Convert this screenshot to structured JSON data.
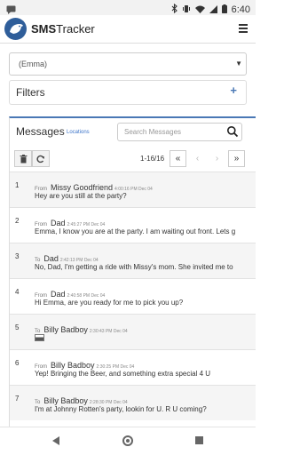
{
  "status_bar": {
    "time": "6:40",
    "icons": [
      "messages-icon",
      "bluetooth-icon",
      "vibrate-icon",
      "wifi-icon",
      "signal-icon",
      "battery-icon"
    ]
  },
  "app": {
    "brand_bold": "SMS",
    "brand_rest": "Tracker"
  },
  "contact_select": {
    "value": "(Emma)"
  },
  "filters": {
    "label": "Filters",
    "add_icon": "plus-icon"
  },
  "messages": {
    "title": "Messages",
    "locations_link": "Locations",
    "search_placeholder": "Search Messages",
    "pager": "1-16/16",
    "accent": "#4a78b5",
    "rows": [
      {
        "num": "1",
        "dir": "From",
        "name": "Missy Goodfriend",
        "time": "4:00:16 PM Dec 04",
        "body": "Hey are you still at the party?"
      },
      {
        "num": "2",
        "dir": "From",
        "name": "Dad",
        "time": "2:45:27 PM Dec 04",
        "body": "Emma, I know you are at the party. I am waiting out front. Lets g"
      },
      {
        "num": "3",
        "dir": "To",
        "name": "Dad",
        "time": "2:42:13 PM Dec 04",
        "body": "No, Dad, I'm getting a ride with Missy's mom. She invited me to"
      },
      {
        "num": "4",
        "dir": "From",
        "name": "Dad",
        "time": "2:40:58 PM Dec 04",
        "body": "Hi Emma, are you ready for me to pick you up?"
      },
      {
        "num": "5",
        "dir": "To",
        "name": "Billy Badboy",
        "time": "2:30:43 PM Dec 04",
        "body": ""
      },
      {
        "num": "6",
        "dir": "From",
        "name": "Billy Badboy",
        "time": "2:30:25 PM Dec 04",
        "body": "Yep! Bringing the Beer, and something extra special 4 U"
      },
      {
        "num": "7",
        "dir": "To",
        "name": "Billy Badboy",
        "time": "2:28:30 PM Dec 04",
        "body": "I'm at Johnny Rotten's party, lookin for U. R U coming?"
      }
    ]
  }
}
